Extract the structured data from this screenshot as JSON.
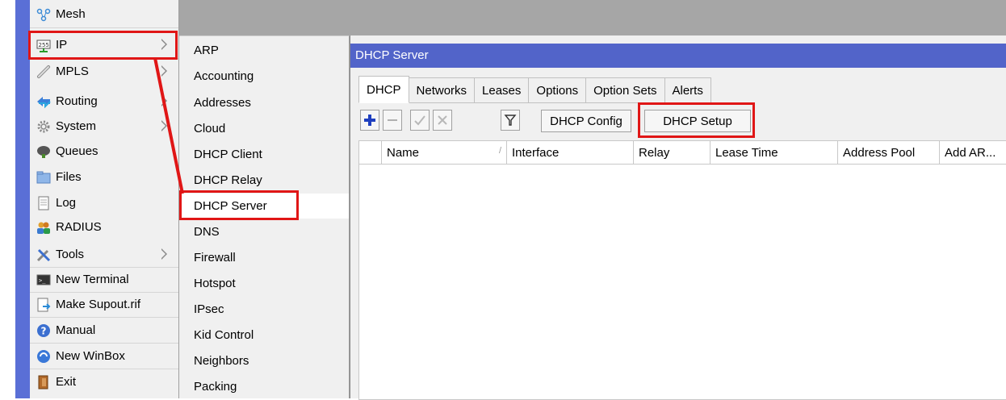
{
  "main_menu": {
    "items": [
      {
        "label": "Mesh",
        "icon": "mesh-icon"
      },
      {
        "label": "IP",
        "icon": "ip-icon",
        "submenu": true
      },
      {
        "label": "MPLS",
        "icon": "mpls-icon",
        "submenu": true
      },
      {
        "label": "Routing",
        "icon": "routing-icon",
        "submenu": true
      },
      {
        "label": "System",
        "icon": "system-gear-icon",
        "submenu": true
      },
      {
        "label": "Queues",
        "icon": "queues-icon"
      },
      {
        "label": "Files",
        "icon": "folder-icon"
      },
      {
        "label": "Log",
        "icon": "log-icon"
      },
      {
        "label": "RADIUS",
        "icon": "radius-users-icon"
      },
      {
        "label": "Tools",
        "icon": "tools-icon",
        "submenu": true
      },
      {
        "label": "New Terminal",
        "icon": "terminal-icon"
      },
      {
        "label": "Make Supout.rif",
        "icon": "supout-icon"
      },
      {
        "label": "Manual",
        "icon": "help-icon"
      },
      {
        "label": "New WinBox",
        "icon": "winbox-icon"
      },
      {
        "label": "Exit",
        "icon": "exit-icon"
      }
    ]
  },
  "ip_submenu": {
    "items": [
      "ARP",
      "Accounting",
      "Addresses",
      "Cloud",
      "DHCP Client",
      "DHCP Relay",
      "DHCP Server",
      "DNS",
      "Firewall",
      "Hotspot",
      "IPsec",
      "Kid Control",
      "Neighbors",
      "Packing"
    ]
  },
  "dhcp_window": {
    "title": "DHCP Server",
    "tabs": [
      "DHCP",
      "Networks",
      "Leases",
      "Options",
      "Option Sets",
      "Alerts"
    ],
    "toolbar": {
      "config_label": "DHCP Config",
      "setup_label": "DHCP Setup"
    },
    "columns": [
      "Name",
      "Interface",
      "Relay",
      "Lease Time",
      "Address Pool",
      "Add AR..."
    ]
  },
  "colors": {
    "highlight": "#e01616",
    "title_bar": "#5264c9",
    "accent_bar": "#5a6fd6"
  }
}
